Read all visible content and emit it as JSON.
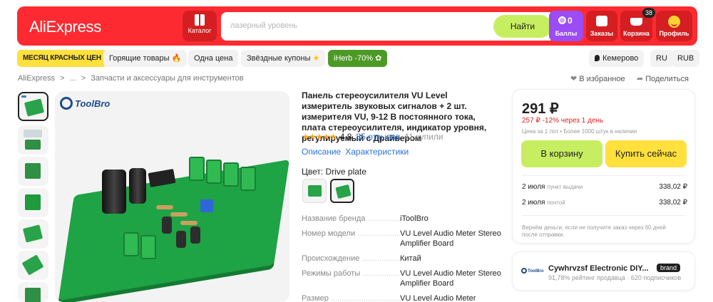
{
  "header": {
    "logo": "AliExpress",
    "catalog_label": "Каталог",
    "search_placeholder": "лазерный уровень",
    "search_button": "Найти",
    "points_count": "0",
    "points_label": "Баллы",
    "orders_label": "Заказы",
    "cart_label": "Корзина",
    "cart_count": "38",
    "profile_label": "Профиль"
  },
  "promo": {
    "red_month": "МЕСЯЦ КРАСНЫХ ЦЕН",
    "hot_deals": "Горящие товары",
    "one_price": "Одна цена",
    "star_coupons": "Звёздные купоны",
    "iherb": "iHerb -70%",
    "city": "Кемерово",
    "language": "RU",
    "currency": "RUB"
  },
  "breadcrumb": {
    "items": [
      "AliExpress",
      ">",
      "...",
      ">",
      "Запчасти и аксессуары для инструментов"
    ],
    "favorites": "В избранное",
    "share": "Поделиться"
  },
  "gallery": {
    "brand_logo": "ToolBro"
  },
  "product": {
    "title": "Панель стереоусилителя VU Level измеритель звуковых сигналов + 2 шт. измерителя VU, 9-12 В постоянного тока, плата стереоусилителя, индикатор уровня, регулируемый с Драйвером",
    "stars": "★★★★★",
    "rating": "4,8",
    "reviews": "85 отзывов",
    "sold": "41 купили",
    "tab_description": "Описание",
    "tab_specs": "Характеристики",
    "color_label": "Цвет: Drive plate",
    "specs": [
      {
        "k": "Название бренда",
        "v": "iToolBro"
      },
      {
        "k": "Номер модели",
        "v": "VU Level Audio Meter Stereo Amplifier Board"
      },
      {
        "k": "Происхождение",
        "v": "Китай"
      },
      {
        "k": "Режимы работы",
        "v": "VU Level Audio Meter Stereo Amplifier Board"
      },
      {
        "k": "Размер",
        "v": "VU Level Audio Meter"
      }
    ]
  },
  "buybox": {
    "price": "291 ₽",
    "old_price": "257 ₽",
    "discount": "-12%",
    "discount_time": "через 1 день",
    "lot_info": "Цена за 1 лот • Более 1000 штук в наличии",
    "add_to_cart": "В корзину",
    "buy_now": "Купить сейчас",
    "delivery": [
      {
        "date": "2 июля",
        "where": "пункт выдачи",
        "amount": "338,02 ₽"
      },
      {
        "date": "2 июля",
        "where": "почтой",
        "amount": "338,02 ₽"
      }
    ],
    "refund": "Вернём деньги, если не получите заказ через 60 дней после отправки."
  },
  "seller": {
    "logo": "ToolBro",
    "name": "Cywhrvzsf Electronic DIY...",
    "badge": "brand",
    "stats": "91,78% рейтинг продавца · 620 подписчиков"
  },
  "colors": {
    "header_bg": "#fd2b31",
    "search_button": "#c7ee60",
    "buy_now": "#ffe03d",
    "points_bg": "#9b4cf5",
    "link": "#2a73d9",
    "stars": "#f9a21b"
  }
}
